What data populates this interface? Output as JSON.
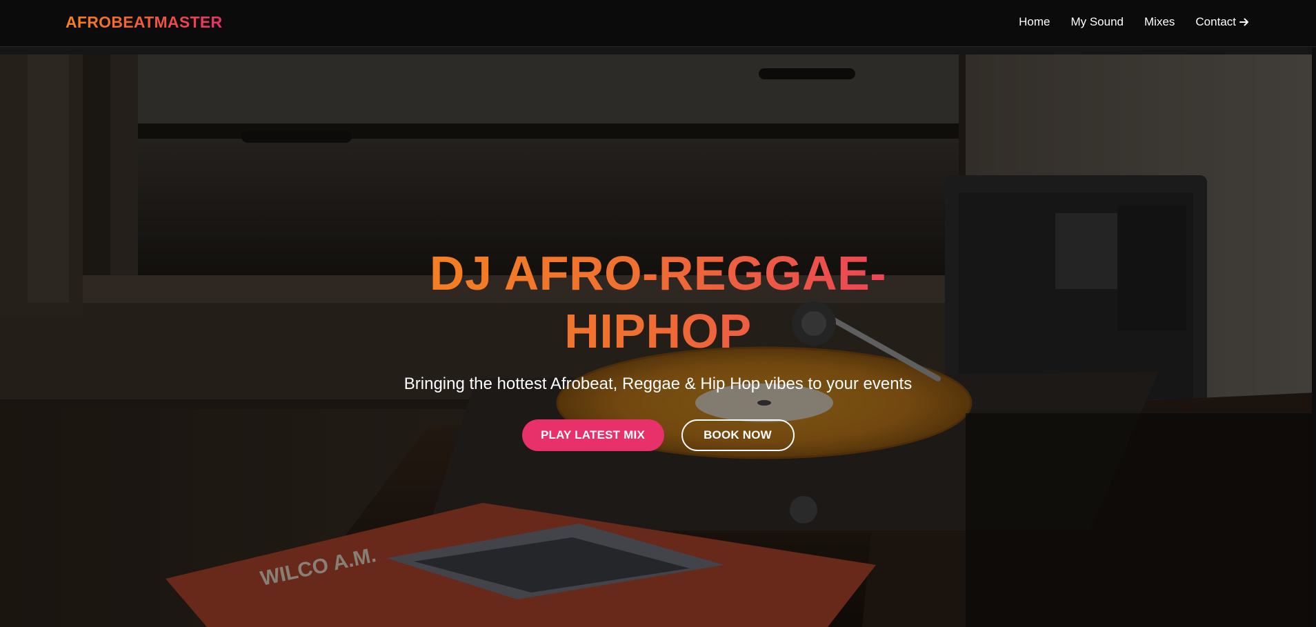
{
  "brand": {
    "name": "AFROBEATMASTER",
    "gradient_start": "#f58220",
    "gradient_end": "#e8306a"
  },
  "nav": {
    "items": [
      {
        "label": "Home"
      },
      {
        "label": "My Sound"
      },
      {
        "label": "Mixes"
      },
      {
        "label": "Contact",
        "icon": "arrow-right-icon"
      }
    ]
  },
  "hero": {
    "title": "DJ AFRO-REGGAE-HIPHOP",
    "subtitle": "Bringing the hottest Afrobeat, Reggae & Hip Hop vibes to your events",
    "background_image": "turntable-photo",
    "record_label_text": "WILCO A.M.",
    "buttons": {
      "primary": "PLAY LATEST MIX",
      "secondary": "BOOK NOW"
    }
  },
  "colors": {
    "accent": "#e8306a",
    "orange": "#f58220",
    "background": "#0a0a0a"
  }
}
